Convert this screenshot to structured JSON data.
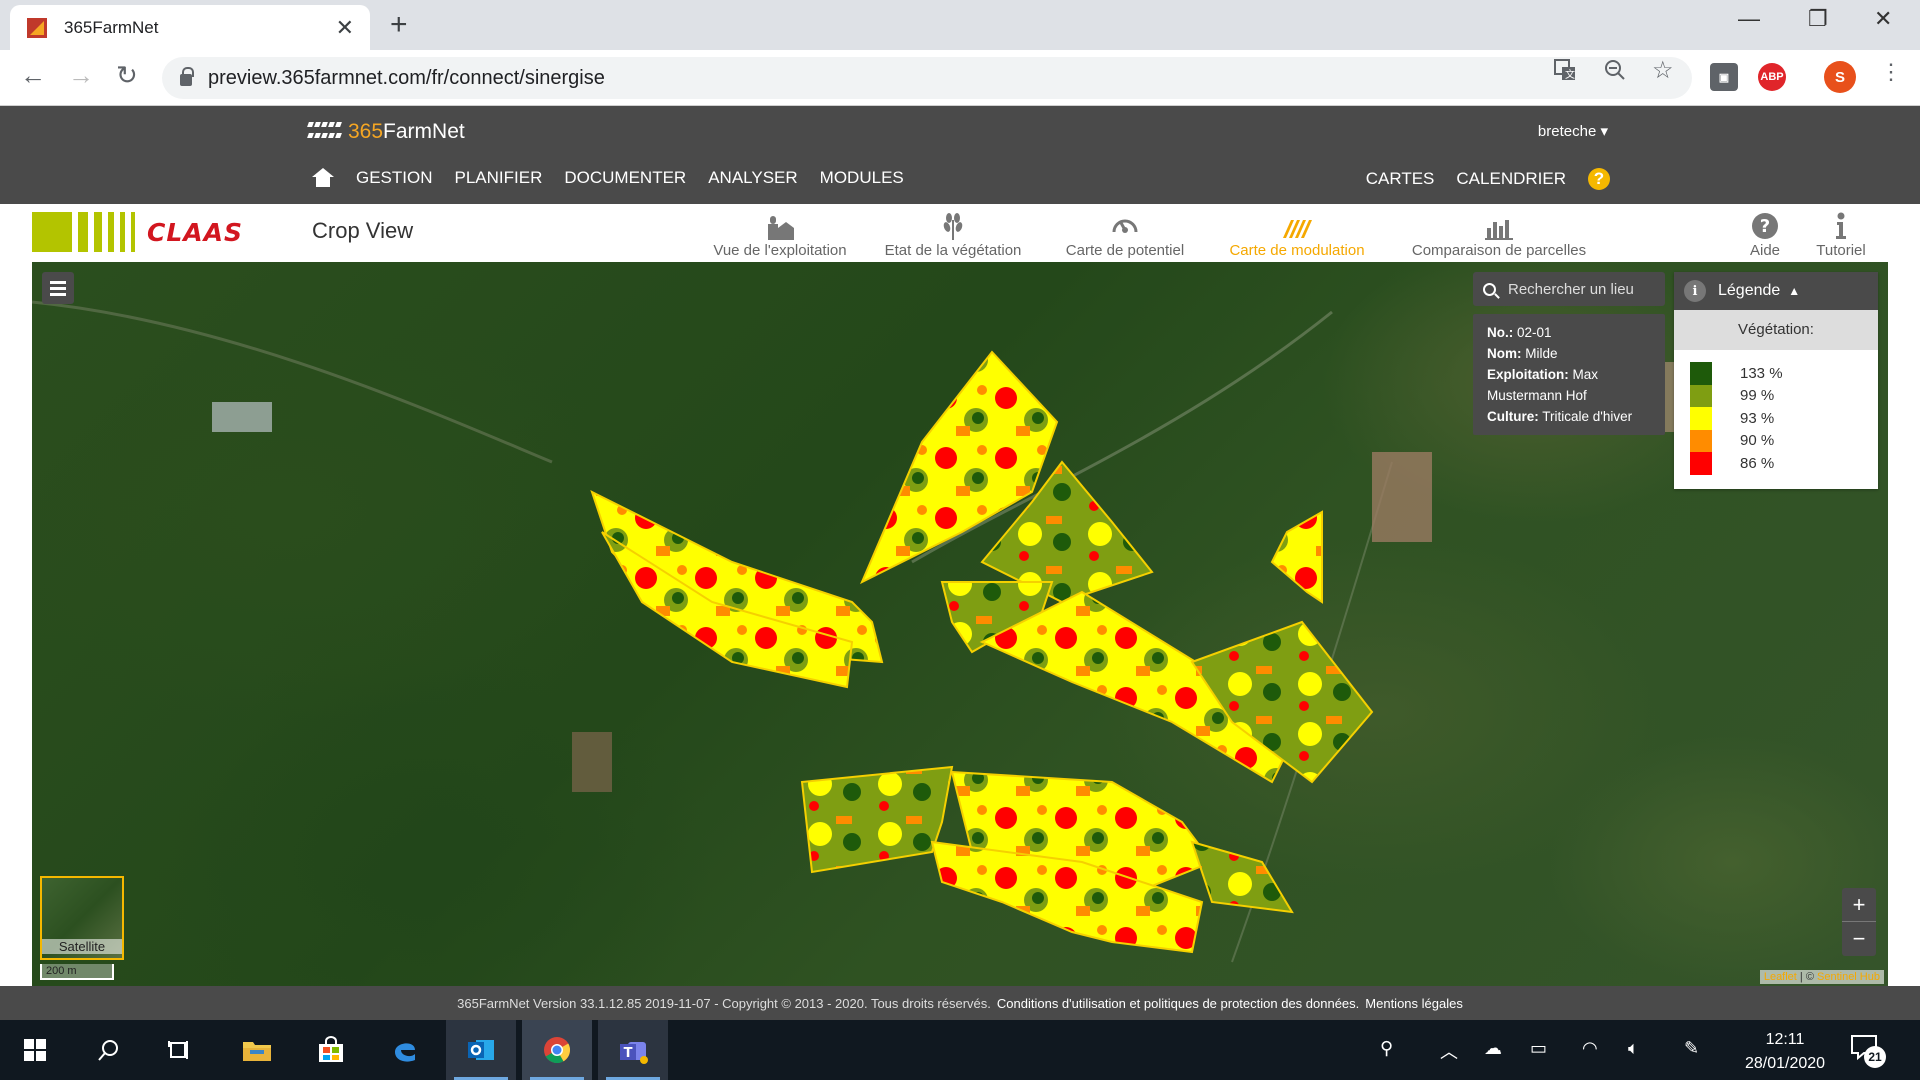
{
  "browser": {
    "tab_title": "365FarmNet",
    "url": "preview.365farmnet.com/fr/connect/sinergise",
    "profile_initial": "S",
    "ext_abp": "ABP"
  },
  "app": {
    "logo_num": "365",
    "logo_text": "FarmNet",
    "user": "bretechе ▾",
    "nav": [
      "GESTION",
      "PLANIFIER",
      "DOCUMENTER",
      "ANALYSER",
      "MODULES"
    ],
    "nav_right": [
      "CARTES",
      "CALENDRIER"
    ],
    "help": "?"
  },
  "cropview": {
    "brand": "CLAAS",
    "title": "Crop View",
    "tools": [
      {
        "label": "Vue de l'exploitation",
        "icon": "farm-icon",
        "active": false
      },
      {
        "label": "Etat de la végétation",
        "icon": "wheat-icon",
        "active": false
      },
      {
        "label": "Carte de potentiel",
        "icon": "gauge-icon",
        "active": false
      },
      {
        "label": "Carte de modulation",
        "icon": "modulation-icon",
        "active": true
      },
      {
        "label": "Comparaison de parcelles",
        "icon": "bar-chart-icon",
        "active": false
      }
    ],
    "aide": "Aide",
    "tutoriel": "Tutoriel"
  },
  "map": {
    "search_placeholder": "Rechercher un lieu",
    "popup": {
      "no_label": "No.:",
      "no_value": "02-01",
      "nom_label": "Nom:",
      "nom_value": "Milde",
      "expl_label": "Exploitation:",
      "expl_value": "Max Mustermann Hof",
      "culture_label": "Culture:",
      "culture_value": "Triticale d'hiver"
    },
    "legend": {
      "title": "Légende",
      "subtitle": "Végétation:",
      "items": [
        {
          "label": "133 %",
          "color": "#1e5a0a"
        },
        {
          "label": "99 %",
          "color": "#7f9e12"
        },
        {
          "label": "93 %",
          "color": "#ffff00"
        },
        {
          "label": "90 %",
          "color": "#ff8c00"
        },
        {
          "label": "86 %",
          "color": "#ff0000"
        }
      ]
    },
    "zoom_in": "+",
    "zoom_out": "−",
    "basemap_label": "Satellite",
    "scale_label": "200 m",
    "attrib_leaflet": "Leaflet",
    "attrib_sep": " | © ",
    "attrib_sentinel": "Sentinel Hub"
  },
  "footer": {
    "version": "365FarmNet Version 33.1.12.85 2019-11-07 - Copyright © 2013 - 2020. Tous droits réservés.",
    "conditions": "Conditions d'utilisation et politiques de protection des données.",
    "mentions": "Mentions légales"
  },
  "taskbar": {
    "time": "12:11",
    "date": "28/01/2020",
    "notif_count": "21"
  }
}
